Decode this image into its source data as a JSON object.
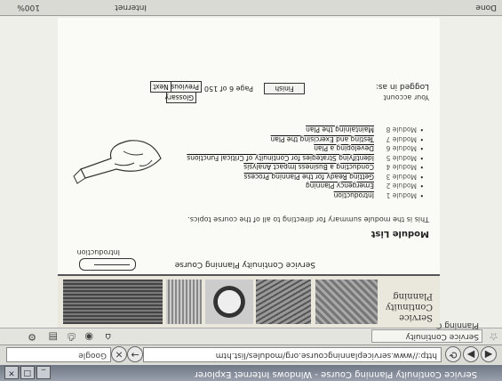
{
  "browser": {
    "title": "Service Continuity Planning Course - Windows Internet Explorer",
    "tab_label": "Service Continuity Planning Course",
    "address": "http://www.serviceplanningcourse.org/modules/list.htm",
    "search_placeholder": "Google",
    "status_text": "Done",
    "zone_text": "Internet",
    "zoom_text": "100%"
  },
  "site": {
    "title": "Service Continuity Planning"
  },
  "page": {
    "course_title": "Service Continuity Planning Course",
    "breadcrumb": "Introduction",
    "section_title": "Module List",
    "intro": "This is the module summary for directing to all of the course topics.",
    "modules": [
      {
        "label": "Module 1",
        "link": "Introduction"
      },
      {
        "label": "Module 2",
        "link": "Emergency Planning"
      },
      {
        "label": "Module 3",
        "link": "Getting Ready for the Planning Process"
      },
      {
        "label": "Module 4",
        "link": "Conducting a Business Impact Analysis"
      },
      {
        "label": "Module 5",
        "link": "Identifying Strategies for Continuity of Critical Functions"
      },
      {
        "label": "Module 6",
        "link": "Developing a Plan"
      },
      {
        "label": "Module 7",
        "link": "Testing and Exercising the Plan"
      },
      {
        "label": "Module 8",
        "link": "Maintaining the Plan"
      }
    ],
    "logged_in": "Logged in as:",
    "logged_user": "Your account",
    "finish_label": "Finish",
    "page_of": "Page 6 of 150",
    "prev_label": "Previous",
    "next_label": "Next",
    "glossary_label": "Glossary"
  }
}
